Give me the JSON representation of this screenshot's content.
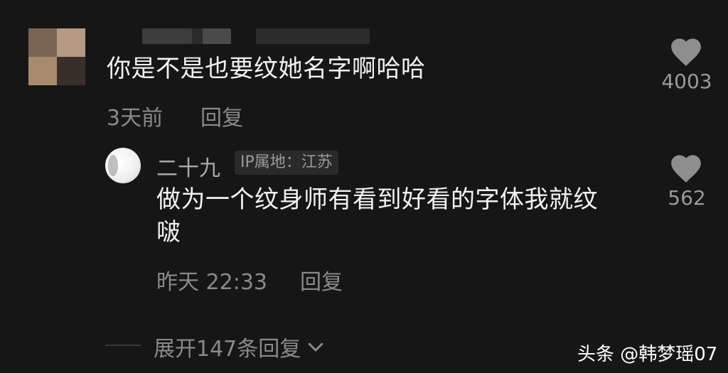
{
  "top_comment": {
    "text": "你是不是也要纹她名字啊哈哈",
    "time": "3天前",
    "reply_label": "回复",
    "likes": "4003"
  },
  "reply_comment": {
    "username": "二十九",
    "ip_location": "IP属地：江苏",
    "text_line1": "做为一个纹身师有看到好看的字体我就纹",
    "text_line2": "啵",
    "time": "昨天 22:33",
    "reply_label": "回复",
    "likes": "562"
  },
  "expand_replies": "展开147条回复",
  "watermark": "头条 @韩梦瑶07"
}
